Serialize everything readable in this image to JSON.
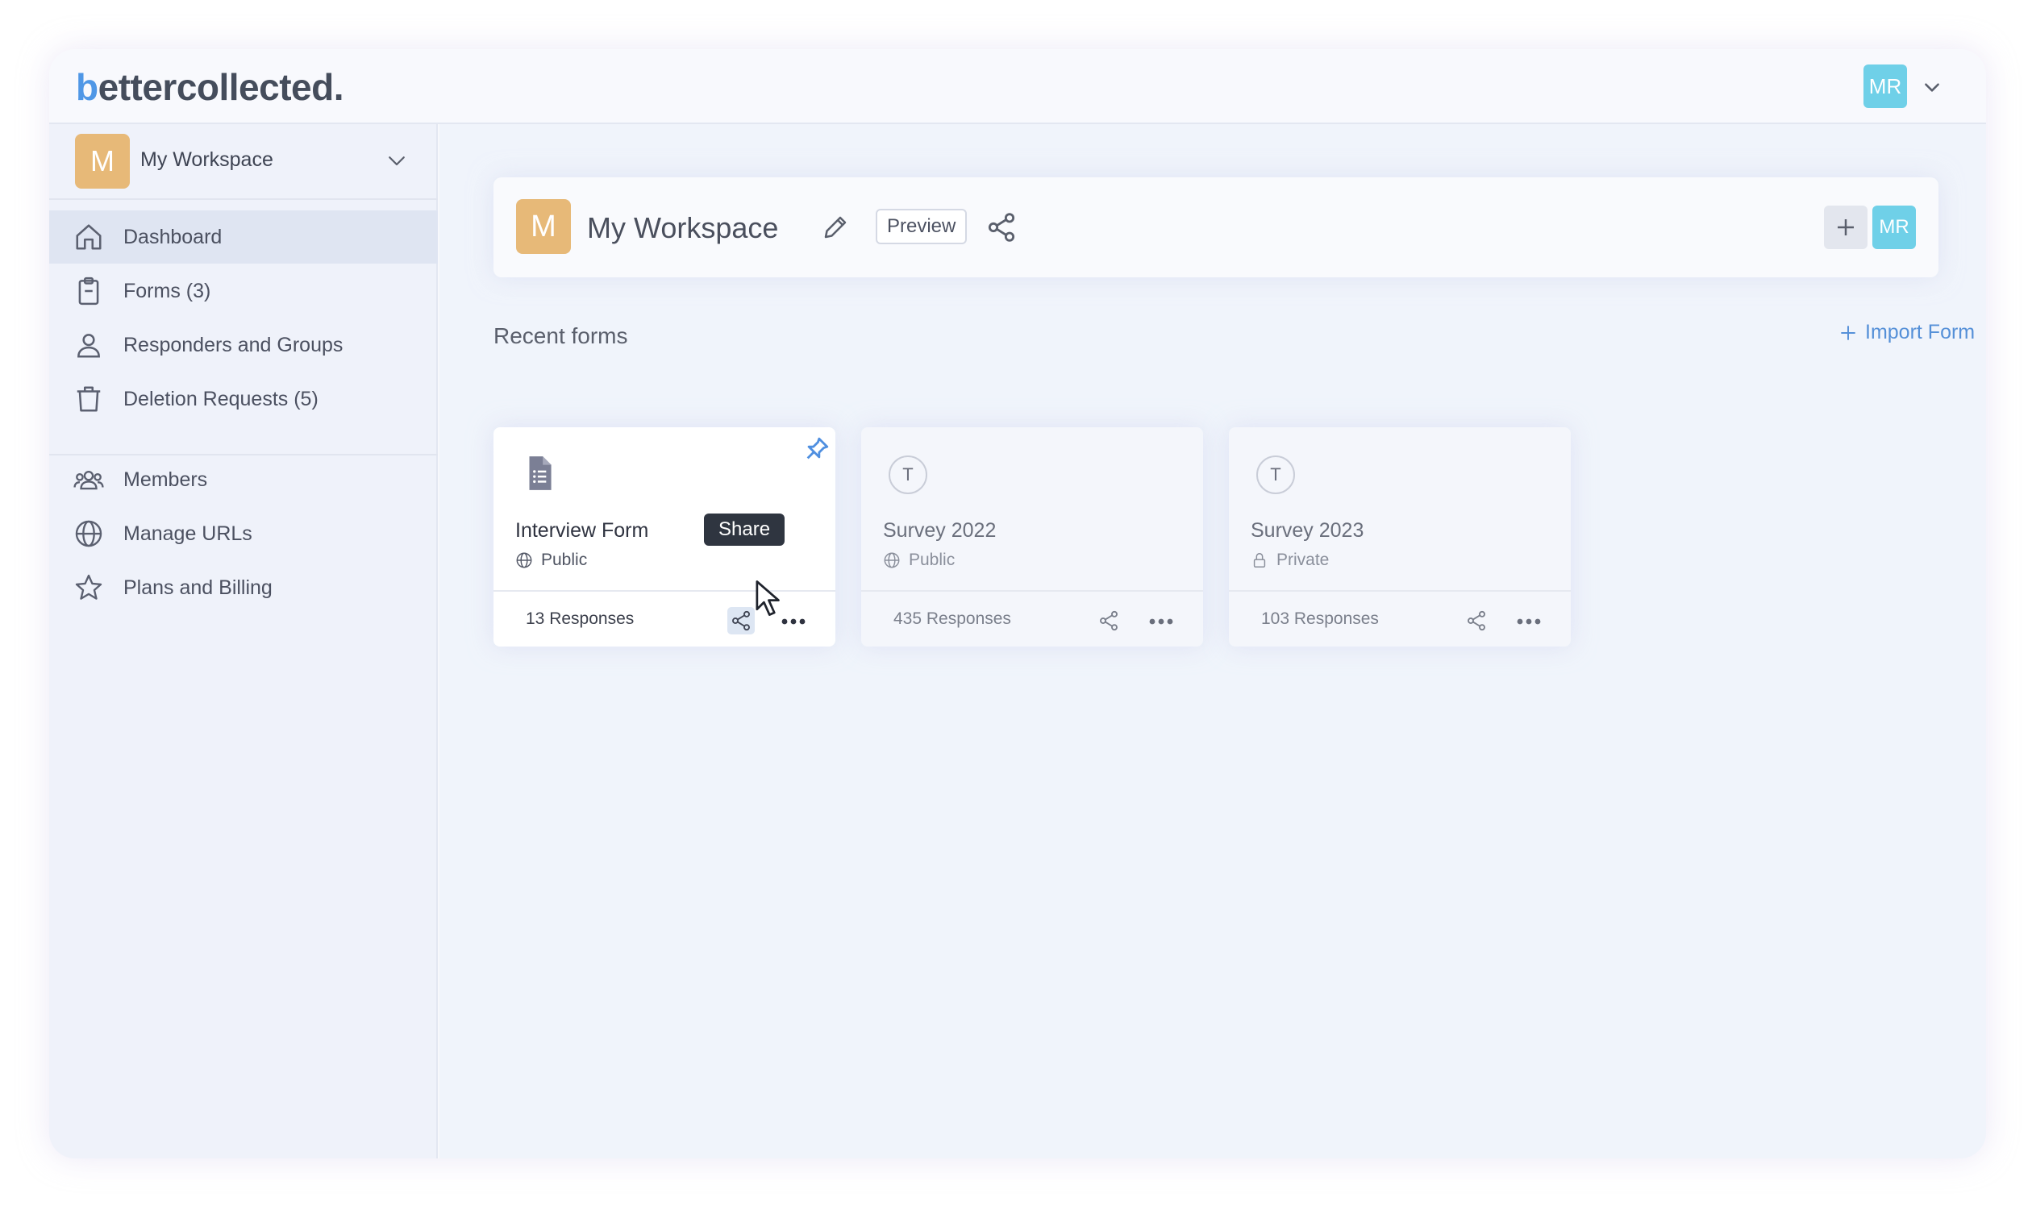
{
  "app": {
    "logo_b": "b",
    "logo_rest": "ettercollected.",
    "user_initials": "MR"
  },
  "sidebar": {
    "workspace": {
      "initial": "M",
      "name": "My Workspace"
    },
    "items": [
      {
        "label": "Dashboard",
        "icon": "home-icon",
        "active": true
      },
      {
        "label": "Forms (3)",
        "icon": "clipboard-icon"
      },
      {
        "label": "Responders and Groups",
        "icon": "user-icon"
      },
      {
        "label": "Deletion Requests (5)",
        "icon": "trash-icon"
      },
      {
        "label": "Members",
        "icon": "users-icon"
      },
      {
        "label": "Manage URLs",
        "icon": "globe-icon"
      },
      {
        "label": "Plans and Billing",
        "icon": "star-icon"
      }
    ]
  },
  "header": {
    "initial": "M",
    "title": "My Workspace",
    "preview_label": "Preview",
    "user_initials": "MR"
  },
  "recent": {
    "title": "Recent forms",
    "import_label": "Import Form",
    "forms": [
      {
        "name": "Interview Form",
        "visibility": "Public",
        "responses": "13 Responses",
        "icon": "document-icon",
        "pinned": true
      },
      {
        "name": "Survey 2022",
        "visibility": "Public",
        "responses": "435 Responses",
        "initial": "T"
      },
      {
        "name": "Survey 2023",
        "visibility": "Private",
        "responses": "103 Responses",
        "initial": "T"
      }
    ]
  },
  "tooltip": {
    "text": "Share"
  },
  "colors": {
    "accent": "#4f97e6",
    "avatar": "#6fd0e8",
    "workspace_badge": "#e7b978"
  }
}
